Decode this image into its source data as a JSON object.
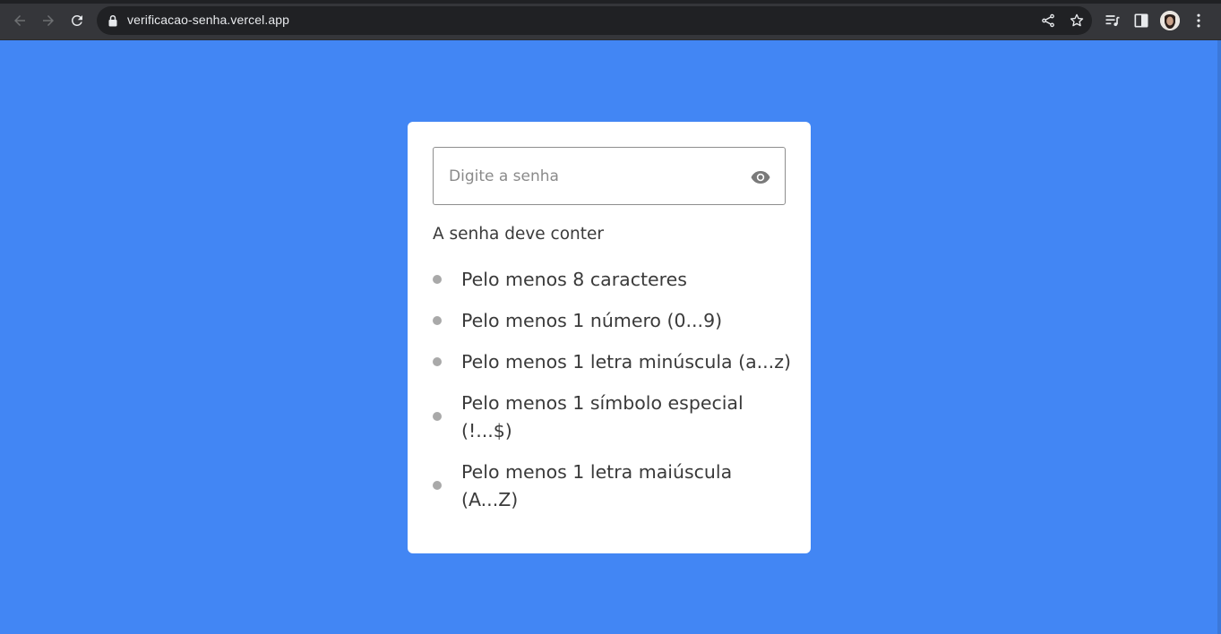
{
  "browser": {
    "url": "verificacao-senha.vercel.app",
    "back_icon": "arrow-left-icon",
    "forward_icon": "arrow-right-icon",
    "reload_icon": "reload-icon",
    "share_icon": "share-icon",
    "bookmark_icon": "star-icon",
    "reading_list_icon": "reading-list-icon",
    "side_panel_icon": "side-panel-icon",
    "menu_icon": "kebab-menu-icon"
  },
  "colors": {
    "page_background": "#4286f4",
    "card_background": "#ffffff",
    "bullet": "#a9a9a9"
  },
  "password": {
    "placeholder": "Digite a senha",
    "value": "",
    "toggle_icon": "eye-icon"
  },
  "requirements": {
    "title": "A senha deve conter",
    "items": [
      {
        "label": "Pelo menos 8 caracteres",
        "met": false
      },
      {
        "label": "Pelo menos 1 número (0...9)",
        "met": false
      },
      {
        "label": "Pelo menos 1 letra minúscula (a...z)",
        "met": false
      },
      {
        "label": "Pelo menos 1 símbolo especial (!...$)",
        "met": false
      },
      {
        "label": "Pelo menos 1 letra maiúscula (A...Z)",
        "met": false
      }
    ]
  }
}
